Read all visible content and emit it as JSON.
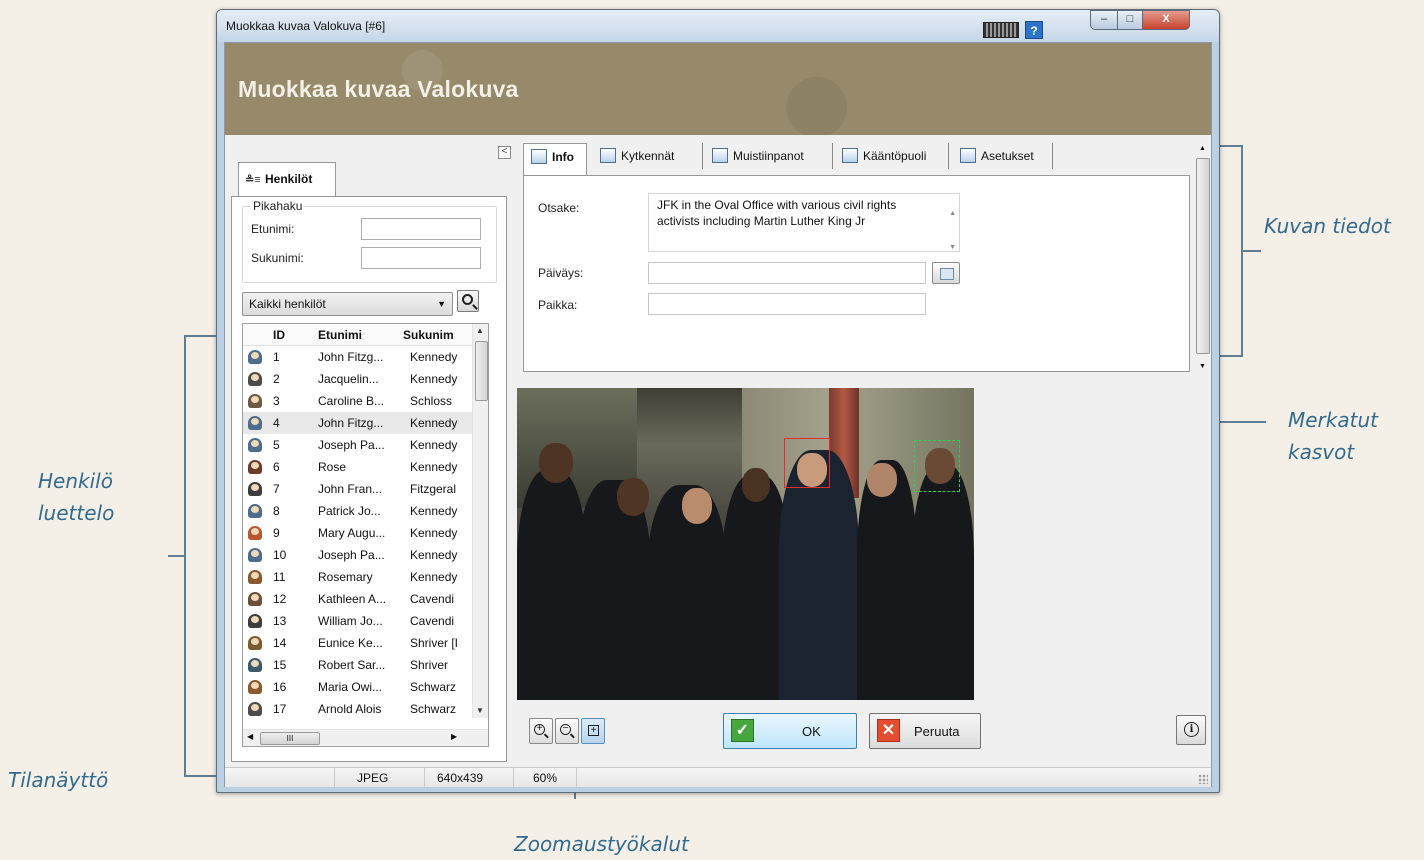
{
  "window": {
    "title": "Muokkaa kuvaa Valokuva [#6]",
    "banner_title": "Muokkaa kuvaa Valokuva",
    "help_label": "?",
    "caption_buttons": {
      "minimize": "–",
      "maximize": "□",
      "close": "X"
    }
  },
  "callouts": {
    "persons": [
      "Henkilö",
      "luettelo"
    ],
    "status": "Tilanäyttö",
    "zoom": "Zoomaustyökalut",
    "info": "Kuvan tiedot",
    "faces": [
      "Merkatut",
      "kasvot"
    ]
  },
  "left_panel": {
    "tab_label": "Henkilöt",
    "quick_search": {
      "title": "Pikahaku",
      "first_name_label": "Etunimi:",
      "first_name_value": "",
      "last_name_label": "Sukunimi:",
      "last_name_value": ""
    },
    "filter_selected": "Kaikki henkilöt",
    "columns": [
      "ID",
      "Etunimi",
      "Sukunim"
    ],
    "scroll_hint": "III",
    "rows": [
      {
        "id": "1",
        "first": "John Fitzg...",
        "last": "Kennedy",
        "color": "#4d6d8c"
      },
      {
        "id": "2",
        "first": "Jacquelin...",
        "last": "Kennedy",
        "color": "#4b4b4b"
      },
      {
        "id": "3",
        "first": "Caroline B...",
        "last": "Schloss",
        "color": "#6d5a46"
      },
      {
        "id": "4",
        "first": "John Fitzg...",
        "last": "Kennedy",
        "color": "#4d6d8c"
      },
      {
        "id": "5",
        "first": "Joseph Pa...",
        "last": "Kennedy",
        "color": "#4d6d8c"
      },
      {
        "id": "6",
        "first": "Rose",
        "last": "Kennedy",
        "color": "#6b3c2c"
      },
      {
        "id": "7",
        "first": "John Fran...",
        "last": "Fitzgeral",
        "color": "#3d3d3d"
      },
      {
        "id": "8",
        "first": "Patrick Jo...",
        "last": "Kennedy",
        "color": "#4d6d8c"
      },
      {
        "id": "9",
        "first": "Mary Augu...",
        "last": "Kennedy",
        "color": "#b9582e"
      },
      {
        "id": "10",
        "first": "Joseph Pa...",
        "last": "Kennedy",
        "color": "#4d6d8c"
      },
      {
        "id": "11",
        "first": "Rosemary",
        "last": "Kennedy",
        "color": "#8a5a2e"
      },
      {
        "id": "12",
        "first": "Kathleen A...",
        "last": "Cavendi",
        "color": "#6b4f3a"
      },
      {
        "id": "13",
        "first": "William Jo...",
        "last": "Cavendi",
        "color": "#3d3d3d"
      },
      {
        "id": "14",
        "first": "Eunice Ke...",
        "last": "Shriver [I",
        "color": "#7a5c2e"
      },
      {
        "id": "15",
        "first": "Robert Sar...",
        "last": "Shriver",
        "color": "#3d5a6d"
      },
      {
        "id": "16",
        "first": "Maria Owi...",
        "last": "Schwarz",
        "color": "#8a5a2e"
      },
      {
        "id": "17",
        "first": "Arnold Alois",
        "last": "Schwarz",
        "color": "#4b4b4b"
      }
    ]
  },
  "tabs": [
    "Info",
    "Kytkennät",
    "Muistiinpanot",
    "Kääntöpuoli",
    "Asetukset"
  ],
  "info": {
    "title_label": "Otsake:",
    "title_value": "JFK in the Oval Office with various civil rights activists including Martin Luther King Jr",
    "date_label": "Päiväys:",
    "date_value": "",
    "place_label": "Paikka:",
    "place_value": ""
  },
  "buttons": {
    "ok_label": "OK",
    "cancel_label": "Peruuta",
    "zoom_in": "+",
    "zoom_out": "−",
    "fit": "+"
  },
  "status": {
    "format": "JPEG",
    "size": "640x439",
    "zoom": "60%"
  }
}
